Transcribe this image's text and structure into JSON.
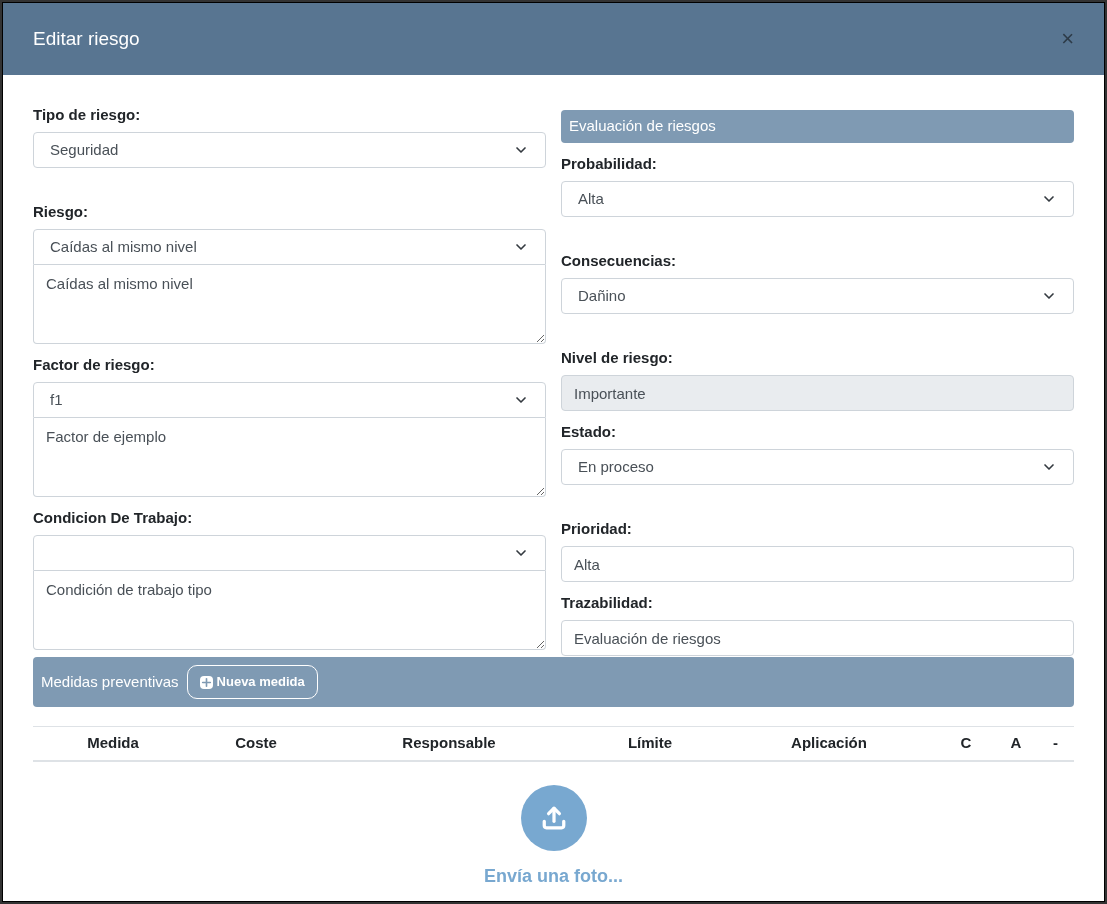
{
  "modal": {
    "title": "Editar riesgo",
    "close": "×"
  },
  "left_fields": [
    {
      "label": "Tipo de riesgo:",
      "kind": "select",
      "value": "Seguridad"
    },
    {
      "label": "Riesgo:",
      "kind": "select",
      "value": "Caídas al mismo nivel",
      "note": "Caídas al mismo nivel"
    },
    {
      "label": "Factor de riesgo:",
      "kind": "select",
      "value": "f1",
      "note": "Factor de ejemplo"
    },
    {
      "label": "Condicion De Trabajo:",
      "kind": "select",
      "note": "Condición de trabajo tipo"
    }
  ],
  "evaluation": {
    "title": "Evaluación de riesgos",
    "fields": [
      {
        "label": "Probabilidad:",
        "kind": "select",
        "value": "Alta"
      },
      {
        "label": "Consecuencias:",
        "kind": "select",
        "value": "Dañino"
      },
      {
        "label": "Nivel de riesgo:",
        "kind": "readonly",
        "value": "Importante"
      },
      {
        "label": "Estado:",
        "kind": "select",
        "value": "En proceso"
      },
      {
        "label": "Prioridad:",
        "kind": "input",
        "value": "Alta"
      },
      {
        "label": "Trazabilidad:",
        "kind": "input",
        "value": "Evaluación de riesgos"
      }
    ]
  },
  "measures": {
    "title": "Medidas preventivas",
    "button": "Nueva medida",
    "columns": [
      "Medida",
      "Coste",
      "Responsable",
      "Límite",
      "Aplicación",
      "C",
      "A",
      "-"
    ]
  },
  "upload": {
    "label": "Envía una foto..."
  }
}
